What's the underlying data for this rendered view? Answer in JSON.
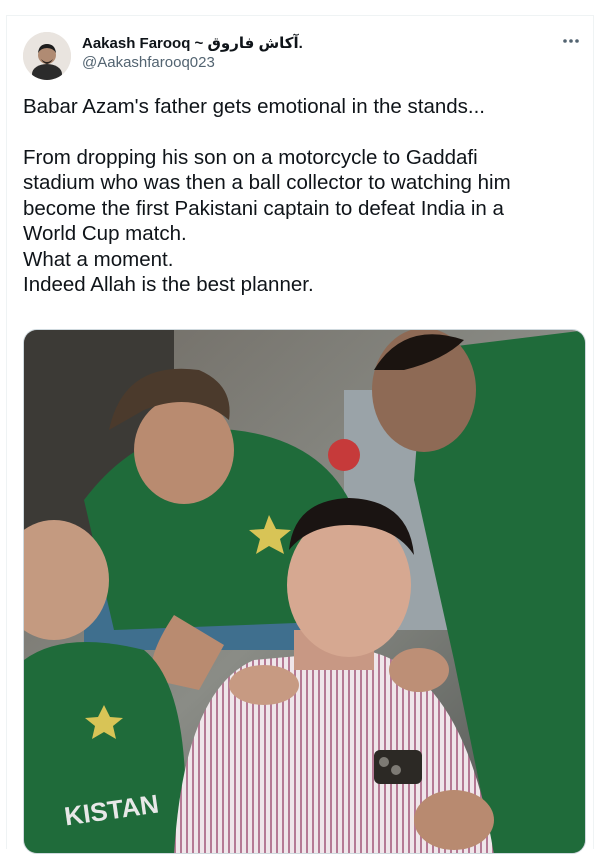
{
  "author": {
    "display_name": "Aakash Farooq ~ آکاش فاروق.",
    "handle": "@Aakashfarooq023"
  },
  "tweet": {
    "lines": [
      "Babar Azam's father gets emotional in the stands...",
      "",
      "From dropping his son on a motorcycle to Gaddafi",
      "stadium who was then a ball collector to watching him",
      "become the first Pakistani captain to defeat India in a",
      "World Cup match.",
      "What a moment.",
      "Indeed Allah is the best planner."
    ]
  },
  "media": {
    "jersey_text": "KISTAN"
  },
  "colors": {
    "text_primary": "#0f1419",
    "text_secondary": "#536471",
    "border": "#cfd9de",
    "jersey_green": "#1f6b3a"
  },
  "icons": {
    "more": "more-horizontal-icon"
  }
}
